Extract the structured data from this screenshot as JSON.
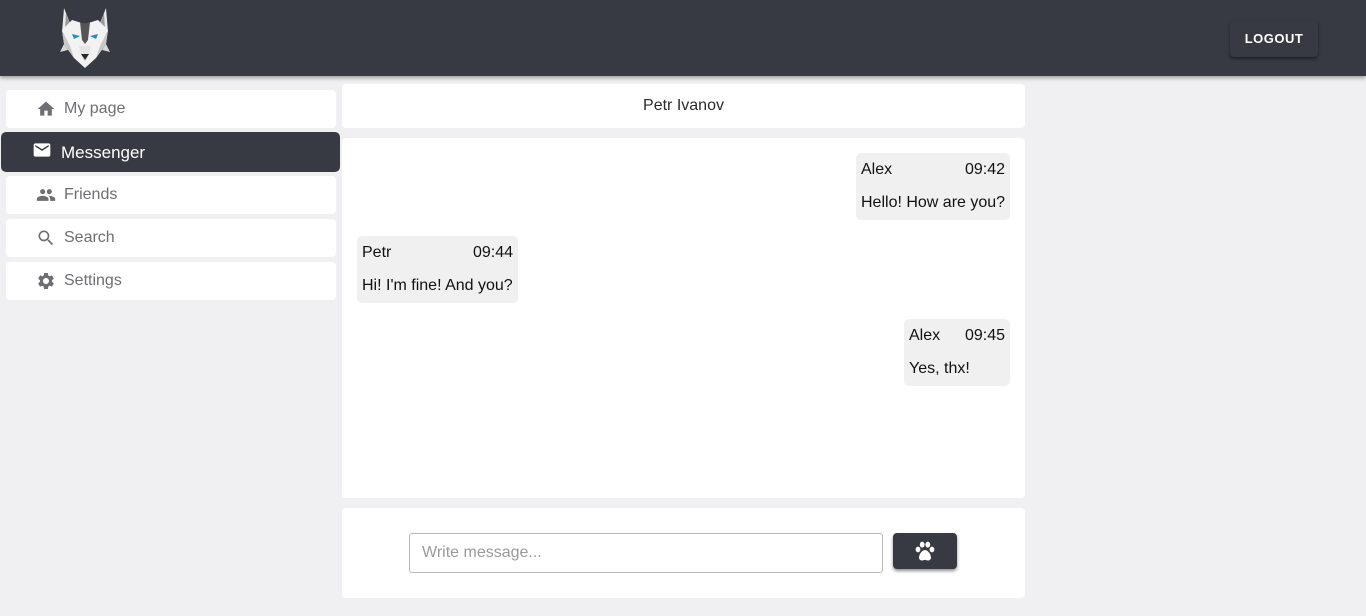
{
  "header": {
    "logo_icon": "wolf-logo-icon",
    "logout_label": "LOGOUT",
    "background_color": "#373a42"
  },
  "sidebar": {
    "items": [
      {
        "label": "My page",
        "icon": "home-icon",
        "active": false
      },
      {
        "label": "Messenger",
        "icon": "mail-icon",
        "active": true
      },
      {
        "label": "Friends",
        "icon": "people-icon",
        "active": false
      },
      {
        "label": "Search",
        "icon": "search-icon",
        "active": false
      },
      {
        "label": "Settings",
        "icon": "gear-icon",
        "active": false
      }
    ]
  },
  "chat": {
    "title": "Petr Ivanov",
    "messages": [
      {
        "author": "Alex",
        "time": "09:42",
        "text": "Hello! How are you?",
        "side": "right"
      },
      {
        "author": "Petr",
        "time": "09:44",
        "text": "Hi! I'm fine! And you?",
        "side": "left"
      },
      {
        "author": "Alex",
        "time": "09:45",
        "text": "Yes, thx!",
        "side": "right"
      }
    ]
  },
  "composer": {
    "placeholder": "Write message...",
    "value": "",
    "send_icon": "paw-icon"
  }
}
